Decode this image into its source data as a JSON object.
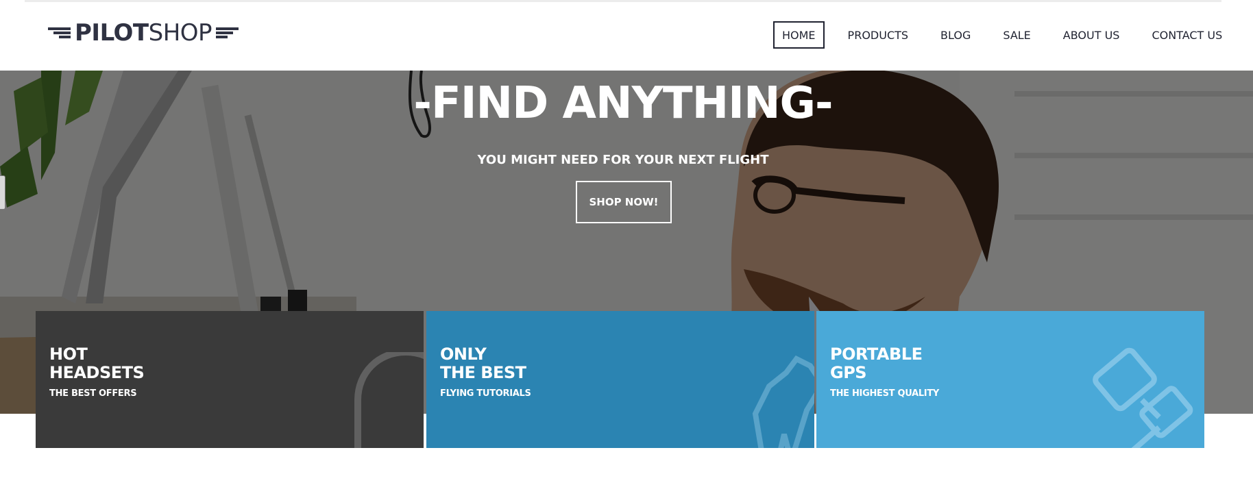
{
  "brand": {
    "bold_part": "PILOT",
    "light_part": "SHOP",
    "logo_icon": "wing-icon"
  },
  "nav": {
    "items": [
      {
        "label": "HOME",
        "active": true
      },
      {
        "label": "PRODUCTS",
        "active": false
      },
      {
        "label": "BLOG",
        "active": false
      },
      {
        "label": "SALE",
        "active": false
      },
      {
        "label": "ABOUT US",
        "active": false
      },
      {
        "label": "CONTACT US",
        "active": false
      }
    ]
  },
  "hero": {
    "title": "-FIND ANYTHING-",
    "subtitle": "YOU MIGHT NEED FOR YOUR NEXT FLIGHT",
    "cta_label": "SHOP NOW!"
  },
  "cards": [
    {
      "title_line1": "HOT",
      "title_line2": "HEADSETS",
      "subtitle": "THE BEST OFFERS",
      "icon": "headset-icon",
      "color": "#3a3a3a"
    },
    {
      "title_line1": "ONLY",
      "title_line2": "THE BEST",
      "subtitle": "FLYING TUTORIALS",
      "icon": "pilot-uniform-icon",
      "color": "#2b84b2"
    },
    {
      "title_line1": "PORTABLE",
      "title_line2": "GPS",
      "subtitle": "THE HIGHEST QUALITY",
      "icon": "gps-device-icon",
      "color": "#4aa9d8"
    }
  ],
  "colors": {
    "text_dark": "#2f3242",
    "card_dark": "#3a3a3a",
    "card_blue": "#2b84b2",
    "card_light_blue": "#4aa9d8"
  }
}
